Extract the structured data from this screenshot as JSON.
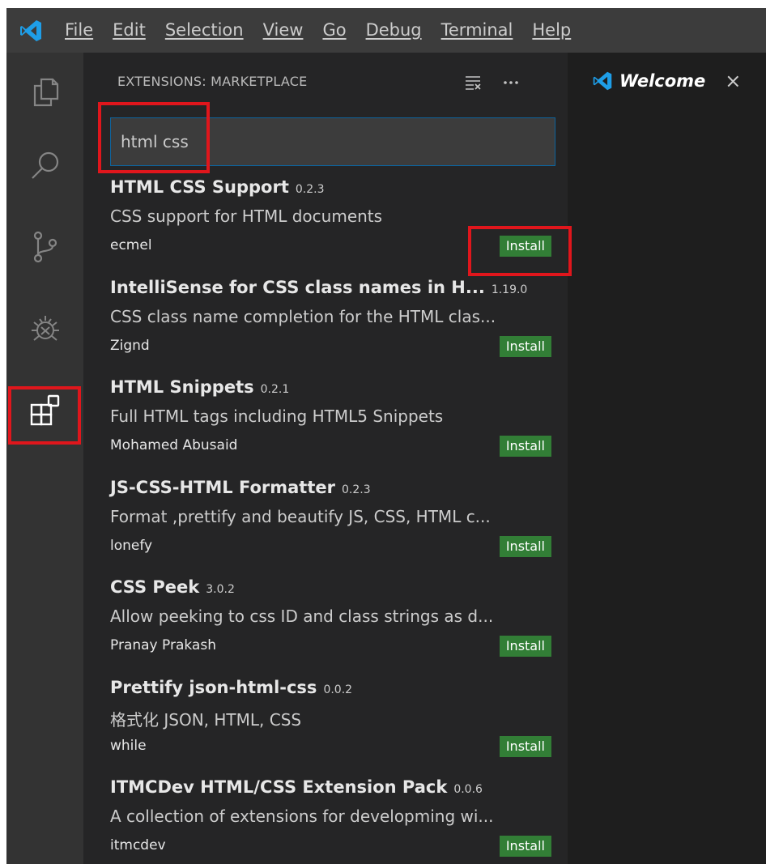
{
  "menu": [
    "File",
    "Edit",
    "Selection",
    "View",
    "Go",
    "Debug",
    "Terminal",
    "Help"
  ],
  "activity": [
    {
      "name": "explorer-icon"
    },
    {
      "name": "search-icon"
    },
    {
      "name": "source-control-icon"
    },
    {
      "name": "debug-icon"
    },
    {
      "name": "extensions-icon"
    }
  ],
  "sidebar": {
    "header": "EXTENSIONS: MARKETPLACE",
    "search_value": "html css"
  },
  "extensions": [
    {
      "name": "HTML CSS Support",
      "version": "0.2.3",
      "description": "CSS support for HTML documents",
      "publisher": "ecmel",
      "install": "Install"
    },
    {
      "name": "IntelliSense for CSS class names in H...",
      "version": "1.19.0",
      "description": "CSS class name completion for the HTML clas...",
      "publisher": "Zignd",
      "install": "Install"
    },
    {
      "name": "HTML Snippets",
      "version": "0.2.1",
      "description": "Full HTML tags including HTML5 Snippets",
      "publisher": "Mohamed Abusaid",
      "install": "Install"
    },
    {
      "name": "JS-CSS-HTML Formatter",
      "version": "0.2.3",
      "description": "Format ,prettify and beautify JS, CSS, HTML c...",
      "publisher": "lonefy",
      "install": "Install"
    },
    {
      "name": "CSS Peek",
      "version": "3.0.2",
      "description": "Allow peeking to css ID and class strings as d...",
      "publisher": "Pranay Prakash",
      "install": "Install"
    },
    {
      "name": "Prettify json-html-css",
      "version": "0.0.2",
      "description": "格式化 JSON, HTML, CSS",
      "publisher": "while",
      "install": "Install"
    },
    {
      "name": "ITMCDev HTML/CSS Extension Pack",
      "version": "0.0.6",
      "description": "A collection of extensions for developming wi...",
      "publisher": "itmcdev",
      "install": "Install"
    }
  ],
  "editor": {
    "tab_title": "Welcome",
    "tab_close": "×"
  },
  "colors": {
    "accent": "#0e639c",
    "install": "#327e36",
    "highlight": "#e0161c"
  }
}
